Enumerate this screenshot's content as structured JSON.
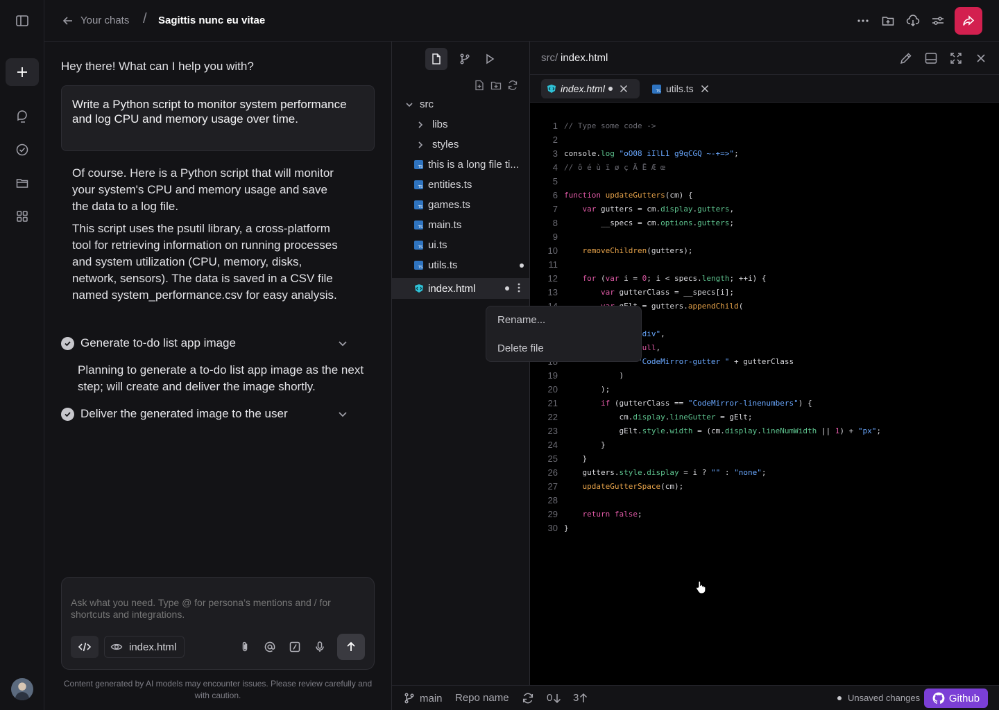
{
  "header": {
    "back_label": "Your chats",
    "separator": "/",
    "chat_title": "Sagittis nunc eu vitae"
  },
  "chat": {
    "greeting": "Hey there! What can I help you with?",
    "user_message": "Write a Python script to monitor system performance and log CPU and memory usage over time.",
    "reply_paragraph_1": "Of course. Here is a Python script that will monitor your system's CPU and memory usage and save the data to a log file.",
    "reply_paragraph_2": "This script uses the psutil library, a cross-platform tool for retrieving information on running processes and system utilization (CPU, memory, disks, network, sensors). The data is saved in a CSV file named system_performance.csv for easy analysis.",
    "steps": [
      {
        "label": "Generate to-do list app image",
        "detail": "Planning to generate a to-do list app image as the next step; will create and deliver the image shortly."
      },
      {
        "label": "Deliver the generated image to the user"
      }
    ],
    "composer": {
      "placeholder": "Ask what you need. Type @ for persona’s mentions and / for shortcuts and integrations.",
      "context_file": "index.html"
    },
    "disclaimer": "Content generated by AI models may encounter issues. Please review carefully and with caution."
  },
  "file_tree": {
    "root_folder": "src",
    "folders": [
      "libs",
      "styles"
    ],
    "files": [
      {
        "name": "this is a long file ti...",
        "icon": "ts-icon",
        "modified": false
      },
      {
        "name": "entities.ts",
        "icon": "ts-icon",
        "modified": false
      },
      {
        "name": "games.ts",
        "icon": "ts-icon",
        "modified": false
      },
      {
        "name": "main.ts",
        "icon": "ts-icon",
        "modified": false
      },
      {
        "name": "ui.ts",
        "icon": "ts-icon",
        "modified": false
      },
      {
        "name": "utils.ts",
        "icon": "ts-icon",
        "modified": true
      },
      {
        "name": "index.html",
        "icon": "html-icon",
        "modified": true,
        "selected": true
      }
    ],
    "context_menu": [
      "Rename...",
      "Delete file"
    ]
  },
  "editor": {
    "path_prefix": "src/",
    "path_file": "index.html",
    "tabs": [
      {
        "name": "index.html",
        "modified": true,
        "active": true
      },
      {
        "name": "utils.ts",
        "modified": false,
        "active": false
      }
    ],
    "line_numbers": [
      "1",
      "2",
      "3",
      "4",
      "5",
      "6",
      "7",
      "8",
      "9",
      "10",
      "11",
      "12",
      "13",
      "14",
      "15",
      "16",
      "17",
      "18",
      "19",
      "20",
      "21",
      "22",
      "23",
      "24",
      "25",
      "26",
      "27",
      "28",
      "29",
      "30"
    ],
    "code_lines": [
      "// Type some code ->",
      "",
      "console.log \"oO08 iIlL1 g9qCGQ ~-+=>\";",
      "// ô é ù ï ø ç Ã Ē Æ œ",
      "",
      "function updateGutters(cm) {",
      "    var gutters = cm.display.gutters,",
      "        __specs = cm.options.gutters;",
      "",
      "    removeChildren(gutters);",
      "",
      "    for (var i = 0; i < specs.length; ++i) {",
      "        var gutterClass = __specs[i];",
      "        var gElt = gutters.appendChild(",
      "            elt(",
      "                \"div\",",
      "                null,",
      "                \"CodeMirror-gutter \" + gutterClass",
      "            )",
      "        );",
      "        if (gutterClass == \"CodeMirror-linenumbers\") {",
      "            cm.display.lineGutter = gElt;",
      "            gElt.style.width = (cm.display.lineNumWidth || 1) + \"px\";",
      "        }",
      "    }",
      "    gutters.style.display = i ? \"\" : \"none\";",
      "    updateGutterSpace(cm);",
      "",
      "    return false;",
      "}"
    ]
  },
  "status_bar": {
    "branch": "main",
    "repo": "Repo name",
    "incoming": "0",
    "outgoing": "3",
    "unsaved": "Unsaved changes",
    "github": "Github"
  },
  "colors": {
    "accent_share": "#d3204f",
    "github_button": "#7b3fd6",
    "panel_bg": "#131316"
  }
}
